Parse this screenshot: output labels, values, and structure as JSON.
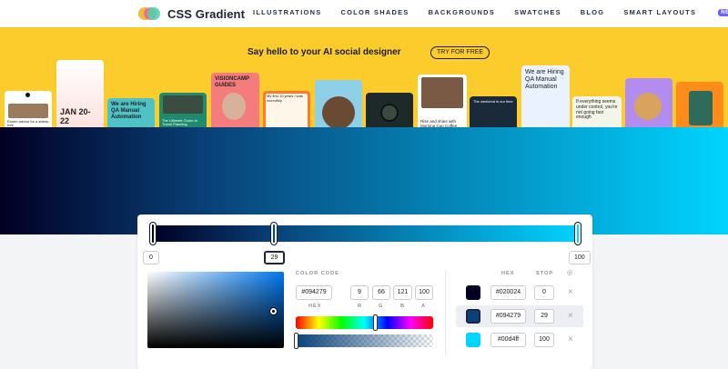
{
  "header": {
    "logo_text": "CSS Gradient",
    "nav": [
      "ILLUSTRATIONS",
      "COLOR SHADES",
      "BACKGROUNDS",
      "SWATCHES",
      "BLOG",
      "SMART LAYOUTS"
    ],
    "new_badge": "NEW"
  },
  "banner": {
    "headline": "Say hello to your AI social designer",
    "cta": "TRY FOR FREE",
    "cards": [
      {
        "text": "Expert advice for a stress-free",
        "bg": "#ffffff"
      },
      {
        "text": "JAN 20-22",
        "bg": "#fde3e0"
      },
      {
        "text": "We are Hiring QA Manual Automation",
        "bg": "#4fc2c8"
      },
      {
        "text": "The Ultimate Guide to Travel Planning",
        "bg": "#1f8a6e"
      },
      {
        "text": "VISIONCAMP GUIDES",
        "bg": "#f47c7c"
      },
      {
        "text": "My first 10 years I was incredibly",
        "bg": "#ff7a2b"
      },
      {
        "text": "",
        "bg": "#8ed0e8"
      },
      {
        "text": "",
        "bg": "#1e2a2a"
      },
      {
        "text": "Rise and shine with Morning Cup Coffee",
        "bg": "#ffffff"
      },
      {
        "text": "The weekend is our time",
        "bg": "#1b2a3a"
      },
      {
        "text": "We are Hiring QA Manual Automation",
        "bg": "#eaf2ff"
      },
      {
        "text": "If everything seems under control, you're not going fast enough",
        "bg": "#f3f5e9"
      },
      {
        "text": "",
        "bg": "#b38cf0"
      },
      {
        "text": "",
        "bg": "#ff8c1a"
      }
    ]
  },
  "gradient": {
    "colors": [
      "#020024",
      "#094279",
      "#00d4ff"
    ],
    "stops": [
      0,
      29,
      100
    ]
  },
  "editor": {
    "stop_labels": [
      "0",
      "29",
      "100"
    ],
    "color_code_label": "COLOR CODE",
    "hex_value": "#094279",
    "r": "9",
    "g": "66",
    "b": "121",
    "a": "100",
    "labels": {
      "hex": "HEX",
      "r": "R",
      "g": "G",
      "b": "B",
      "a": "A"
    },
    "table_headers": {
      "hex": "HEX",
      "stop": "STOP"
    },
    "rows": [
      {
        "color": "#020024",
        "hex": "#020024",
        "stop": "0"
      },
      {
        "color": "#094279",
        "hex": "#094279",
        "stop": "29"
      },
      {
        "color": "#00d4ff",
        "hex": "#00d4ff",
        "stop": "100"
      }
    ],
    "remove_icon": "×",
    "visibility_icon": "eye-icon"
  }
}
